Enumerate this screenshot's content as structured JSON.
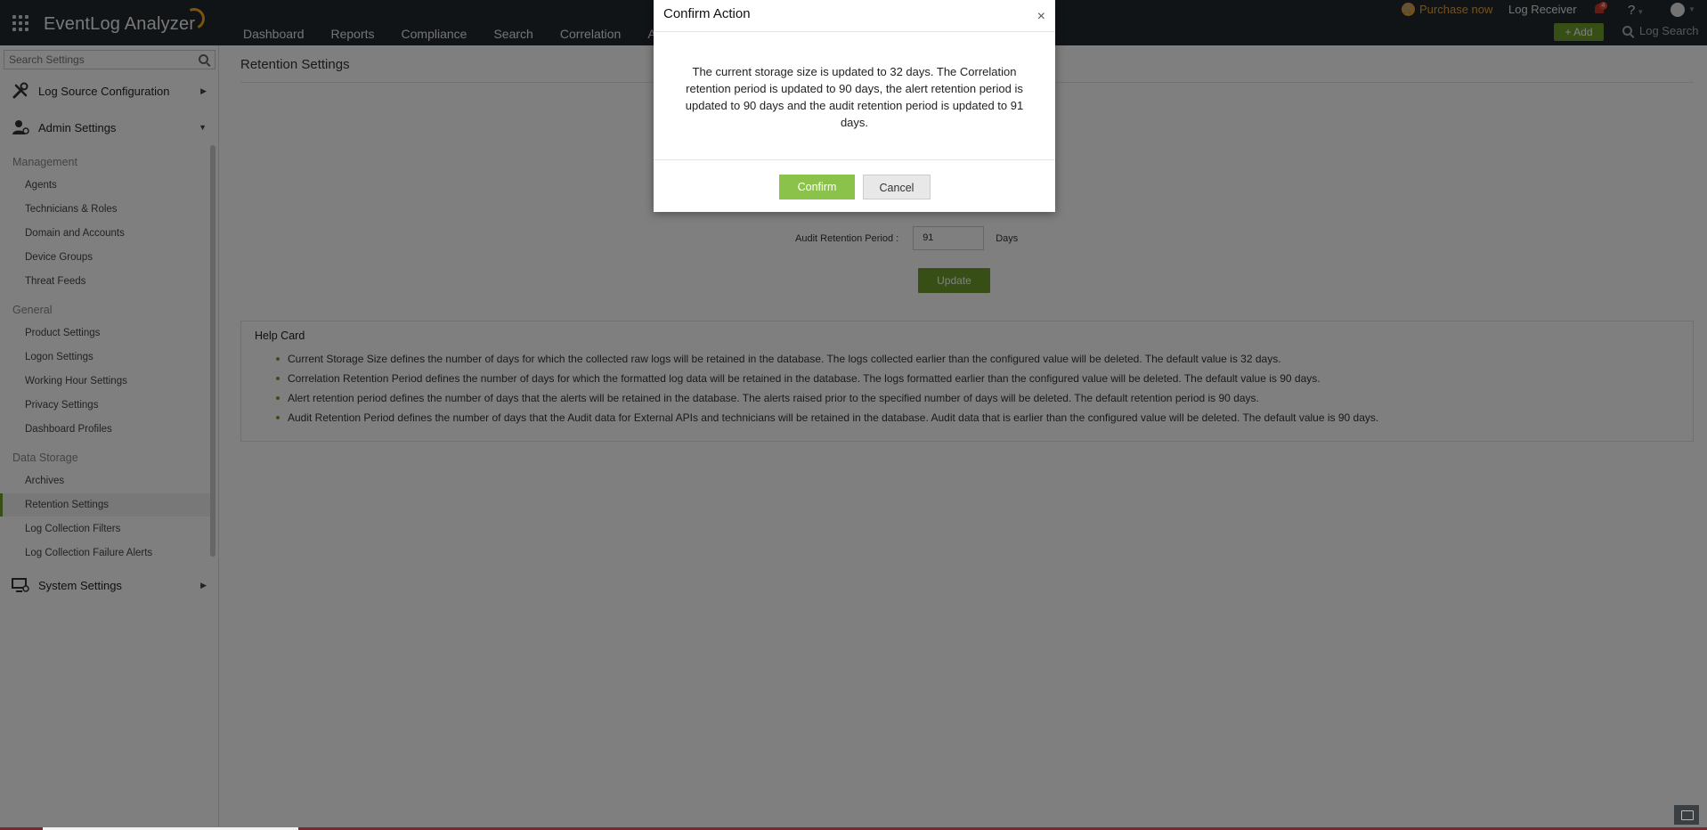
{
  "app": {
    "name": "EventLog Analyzer"
  },
  "topnav": {
    "items": [
      "Dashboard",
      "Reports",
      "Compliance",
      "Search",
      "Correlation",
      "A"
    ],
    "purchase": "Purchase now",
    "log_receiver": "Log Receiver",
    "notification_count": "4",
    "help": "?",
    "add": "+ Add",
    "log_search": "Log Search"
  },
  "sidebar": {
    "search_placeholder": "Search Settings",
    "sections": {
      "log_source": "Log Source Configuration",
      "admin": "Admin Settings",
      "system": "System Settings"
    },
    "groups": {
      "management": "Management",
      "general": "General",
      "data_storage": "Data Storage"
    },
    "management_items": [
      "Agents",
      "Technicians & Roles",
      "Domain and Accounts",
      "Device Groups",
      "Threat Feeds"
    ],
    "general_items": [
      "Product Settings",
      "Logon Settings",
      "Working Hour Settings",
      "Privacy Settings",
      "Dashboard Profiles"
    ],
    "data_storage_items": [
      "Archives",
      "Retention Settings",
      "Log Collection Filters",
      "Log Collection Failure Alerts"
    ],
    "active_item": "Retention Settings"
  },
  "main": {
    "title": "Retention Settings",
    "audit_label": "Audit Retention Period :",
    "audit_value": "91",
    "days_unit": "Days",
    "update": "Update",
    "help_card": {
      "title": "Help Card",
      "items": [
        "Current Storage Size defines the number of days for which the collected raw logs will be retained in the database. The logs collected earlier than the configured value will be deleted. The default value is 32 days.",
        "Correlation Retention Period defines the number of days for which the formatted log data will be retained in the database. The logs formatted earlier than the configured value will be deleted. The default value is 90 days.",
        "Alert retention period defines the number of days that the alerts will be retained in the database. The alerts raised prior to the specified number of days will be deleted. The default retention period is 90 days.",
        "Audit Retention Period defines the number of days that the Audit data for External APIs and technicians will be retained in the database. Audit data that is earlier than the configured value will be deleted. The default value is 90 days."
      ]
    }
  },
  "modal": {
    "title": "Confirm Action",
    "close": "×",
    "message": "The current storage size is updated to 32 days. The Correlation retention period is updated to 90 days, the alert retention period is updated to 90 days and the audit retention period is updated to 91 days.",
    "confirm": "Confirm",
    "cancel": "Cancel"
  },
  "colors": {
    "topbar": "#22282e",
    "accent_green": "#6e9f2d",
    "confirm_green": "#8bc34a",
    "purchase_orange": "#e6a23c"
  }
}
